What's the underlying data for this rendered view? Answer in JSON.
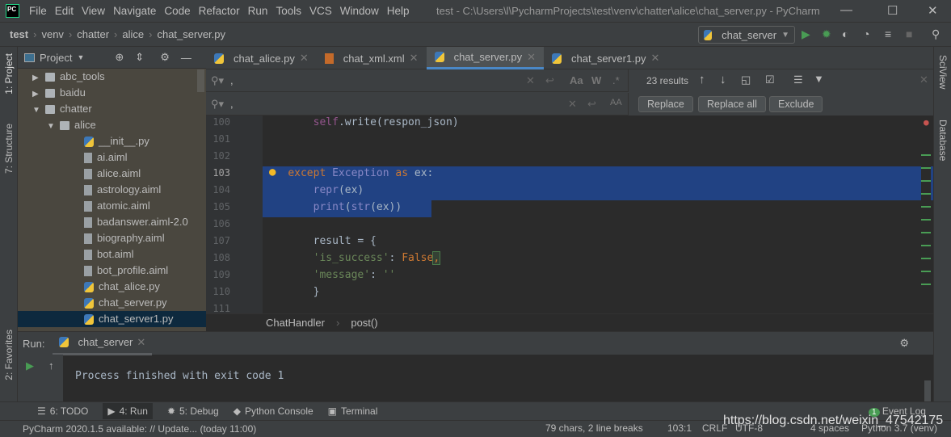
{
  "app": {
    "logo": "PC",
    "title": "test - C:\\Users\\l\\PycharmProjects\\test\\venv\\chatter\\alice\\chat_server.py - PyCharm"
  },
  "menu": [
    "File",
    "Edit",
    "View",
    "Navigate",
    "Code",
    "Refactor",
    "Run",
    "Tools",
    "VCS",
    "Window",
    "Help"
  ],
  "breadcrumb": [
    "test",
    "venv",
    "chatter",
    "alice",
    "chat_server.py"
  ],
  "run_config": "chat_server",
  "left_stripe": [
    "1: Project",
    "7: Structure",
    "2: Favorites"
  ],
  "right_stripe": [
    "SciView",
    "Database"
  ],
  "project": {
    "title": "Project",
    "items": [
      {
        "label": "abc_tools",
        "type": "folder",
        "depth": 1,
        "expanded": false
      },
      {
        "label": "baidu",
        "type": "folder",
        "depth": 1,
        "expanded": false
      },
      {
        "label": "chatter",
        "type": "folder",
        "depth": 1,
        "expanded": true
      },
      {
        "label": "alice",
        "type": "folder",
        "depth": 2,
        "expanded": true
      },
      {
        "label": "__init__.py",
        "type": "py",
        "depth": 3
      },
      {
        "label": "ai.aiml",
        "type": "file",
        "depth": 3
      },
      {
        "label": "alice.aiml",
        "type": "file",
        "depth": 3
      },
      {
        "label": "astrology.aiml",
        "type": "file",
        "depth": 3
      },
      {
        "label": "atomic.aiml",
        "type": "file",
        "depth": 3
      },
      {
        "label": "badanswer.aiml-2.0",
        "type": "file",
        "depth": 3
      },
      {
        "label": "biography.aiml",
        "type": "file",
        "depth": 3
      },
      {
        "label": "bot.aiml",
        "type": "file",
        "depth": 3
      },
      {
        "label": "bot_profile.aiml",
        "type": "file",
        "depth": 3
      },
      {
        "label": "chat_alice.py",
        "type": "py",
        "depth": 3
      },
      {
        "label": "chat_server.py",
        "type": "py",
        "depth": 3
      },
      {
        "label": "chat_server1.py",
        "type": "py",
        "depth": 3,
        "selected": true
      }
    ]
  },
  "tabs": [
    {
      "label": "chat_alice.py"
    },
    {
      "label": "chat_xml.xml"
    },
    {
      "label": "chat_server.py",
      "active": true
    },
    {
      "label": "chat_server1.py"
    }
  ],
  "find": {
    "search_value": ",",
    "replace_value": ",",
    "results": "23 results",
    "replace": "Replace",
    "replace_all": "Replace all",
    "exclude": "Exclude",
    "match_case": "Aa",
    "words": "W",
    "regex": ".*",
    "preserve_case": "AA"
  },
  "code": {
    "lines": [
      {
        "n": "100",
        "html": "        <span class='sf'>self</span>.write(respon_json)"
      },
      {
        "n": "101",
        "html": ""
      },
      {
        "n": "102",
        "html": ""
      },
      {
        "n": "103",
        "html": "    <span class='kw'>except</span> <span class='bi'>Exception</span> <span class='kw'>as</span> ex:"
      },
      {
        "n": "104",
        "html": "        <span class='bi'>repr</span>(ex)"
      },
      {
        "n": "105",
        "html": "        <span class='bi'>print</span>(<span class='bi'>str</span>(ex))"
      },
      {
        "n": "106",
        "html": ""
      },
      {
        "n": "107",
        "html": "        result = {"
      },
      {
        "n": "108",
        "html": "        <span class='st'>'is_success'</span>: <span class='kw'>False</span><span class='kw' style='background:#344134;outline:1px solid #4a7a4a'>,</span>"
      },
      {
        "n": "109",
        "html": "        <span class='st'>'message'</span>: <span class='st'>''</span>"
      },
      {
        "n": "110",
        "html": "        }"
      },
      {
        "n": "111",
        "html": ""
      }
    ]
  },
  "code_breadcrumb": [
    "ChatHandler",
    "post()"
  ],
  "run": {
    "label": "Run:",
    "tab": "chat_server",
    "output": "Process finished with exit code 1"
  },
  "tool_windows": [
    "6: TODO",
    "4: Run",
    "5: Debug",
    "Python Console",
    "Terminal"
  ],
  "event_log": {
    "label": "Event Log",
    "count": "1"
  },
  "status": {
    "message": "PyCharm 2020.1.5 available: // Update... (today 11:00)",
    "selection": "79 chars, 2 line breaks",
    "position": "103:1",
    "line_sep": "CRLF",
    "encoding": "UTF-8",
    "indent": "4 spaces",
    "interpreter": "Python 3.7 (venv)",
    "watermark": "https://blog.csdn.net/weixin_47542175"
  },
  "colors": {
    "accent": "#4a88c7",
    "selection": "#214283",
    "run_green": "#499c54"
  }
}
